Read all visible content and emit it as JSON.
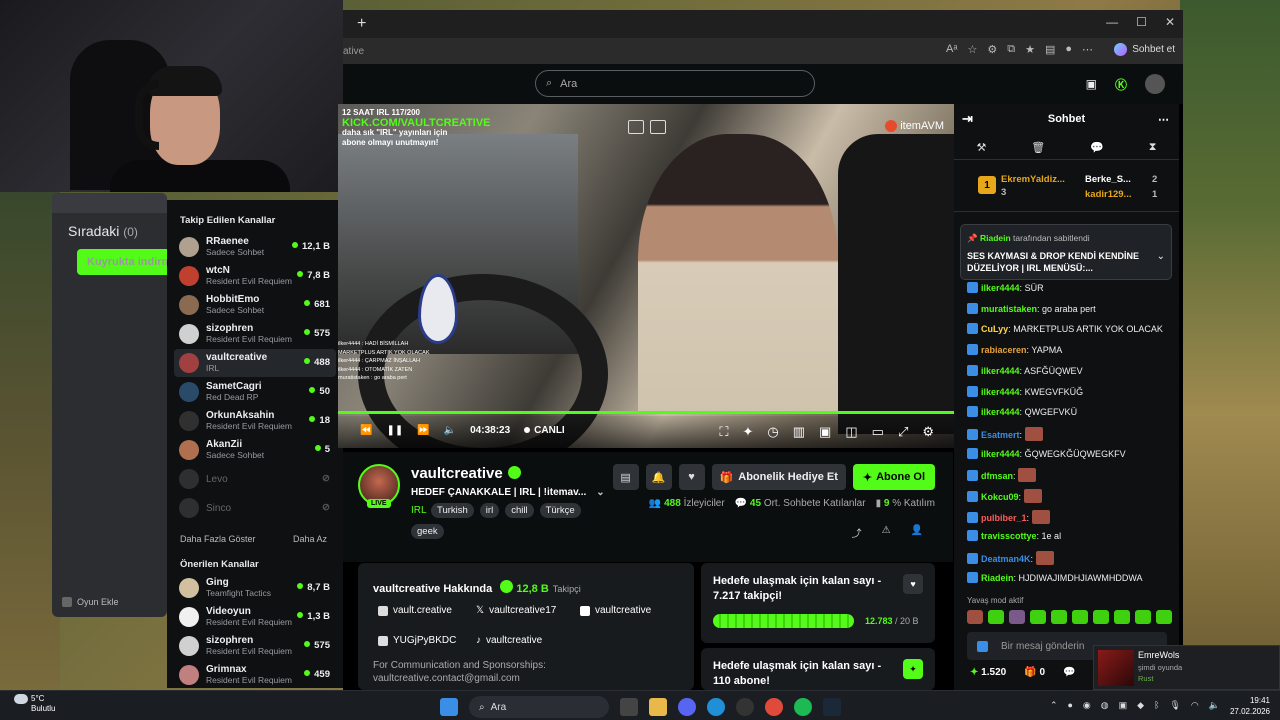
{
  "queue": {
    "title": "Sıradaki",
    "count": "(0)",
    "empty": "Kuyrukta indirme",
    "footer": "Oyun Ekle"
  },
  "browser": {
    "url_fragment": "ative",
    "sohbet_et": "Sohbet et"
  },
  "header": {
    "search_placeholder": "Ara"
  },
  "sidebar": {
    "followed_title": "Takip Edilen Kanallar",
    "followed": [
      {
        "name": "RRaenee",
        "category": "Sadece Sohbet",
        "viewers": "12,1 B",
        "color": "#b0a090"
      },
      {
        "name": "wtcN",
        "category": "Resident Evil Requiem",
        "viewers": "7,8 B",
        "color": "#c04030"
      },
      {
        "name": "HobbitEmo",
        "category": "Sadece Sohbet",
        "viewers": "681",
        "color": "#8a6a50"
      },
      {
        "name": "sizophren",
        "category": "Resident Evil Requiem",
        "viewers": "575",
        "color": "#d0d0d0"
      },
      {
        "name": "vaultcreative",
        "category": "IRL",
        "viewers": "488",
        "color": "#a04040"
      },
      {
        "name": "SametCagri",
        "category": "Red Dead RP",
        "viewers": "50",
        "color": "#2a4a6a"
      },
      {
        "name": "OrkunAksahin",
        "category": "Resident Evil Requiem",
        "viewers": "18",
        "color": "#303030"
      },
      {
        "name": "AkanZii",
        "category": "Sadece Sohbet",
        "viewers": "5",
        "color": "#b07050"
      },
      {
        "name": "Levo",
        "category": "",
        "viewers": "",
        "color": "#555"
      },
      {
        "name": "Sinco",
        "category": "",
        "viewers": "",
        "color": "#555"
      }
    ],
    "show_more": "Daha Fazla Göster",
    "show_less": "Daha Az",
    "recommended_title": "Önerilen Kanallar",
    "recommended": [
      {
        "name": "Ging",
        "category": "Teamfight Tactics",
        "viewers": "8,7 B",
        "color": "#d0c0a0"
      },
      {
        "name": "Videoyun",
        "category": "Resident Evil Requiem",
        "viewers": "1,3 B",
        "color": "#f0f0f0"
      },
      {
        "name": "sizophren",
        "category": "Resident Evil Requiem",
        "viewers": "575",
        "color": "#d0d0d0"
      },
      {
        "name": "Grimnax",
        "category": "Resident Evil Requiem",
        "viewers": "459",
        "color": "#c08080"
      }
    ]
  },
  "video": {
    "overlay_line1": "12 SAAT IRL 117/200",
    "overlay_kick": "KICK.COM/VAULTCREATIVE",
    "overlay_line3": "daha sık \"IRL\" yayınları için",
    "overlay_line4": "abone olmayı unutmayın!",
    "sponsor": "itemAVM",
    "time": "04:38:23",
    "live_label": "CANLI",
    "overlay_chat": [
      "ilker4444 : HADİ BİSMİLLAH",
      "MARKETPLUS ARTIK YOK OLACAK",
      "ilker4444 : ÇARPMAZ İNŞALLAH",
      "ilker4444 : OTOMATİK ZATEN",
      "muratistaken : go araba pert"
    ]
  },
  "stream": {
    "name": "vaultcreative",
    "title": "HEDEF ÇANAKKALE | IRL | !itemav...",
    "category": "IRL",
    "tags": [
      "Turkish",
      "irl",
      "chill",
      "Türkçe",
      "geek"
    ],
    "live_badge": "LIVE",
    "gift_label": "Abonelik Hediye Et",
    "subscribe_label": "Abone Ol",
    "viewers": "488",
    "viewers_label": "İzleyiciler",
    "chatters": "45",
    "chatters_label": "Ort. Sohbete Katılanlar",
    "participation": "9",
    "participation_label": "% Katılım"
  },
  "about": {
    "title": "vaultcreative Hakkında",
    "followers": "12,8 B",
    "followers_label": "Takipçi",
    "instagram": "vault.creative",
    "x": "vaultcreative17",
    "youtube": "vaultcreative",
    "discord": "YUGjPyBKDC",
    "tiktok": "vaultcreative",
    "desc_line1": "For Communication and Sponsorships:",
    "desc_line2": "vaultcreative.contact@gmail.com"
  },
  "goals": [
    {
      "title": "Hedefe ulaşmak için kalan sayı - 7.217 takipçi!",
      "current": "12.783",
      "target": "/ 20 B",
      "progress": 0.64
    },
    {
      "title": "Hedefe ulaşmak için kalan sayı - 110 abone!"
    }
  ],
  "chat": {
    "title": "Sohbet",
    "leaderboard": [
      {
        "name": "EkremYaldiz...",
        "count": "3"
      },
      {
        "name": "Berke_S...",
        "count": "2"
      },
      {
        "name": "kadir129...",
        "count": "1"
      }
    ],
    "pinned_by": "Riadein",
    "pinned_by_suffix": "tarafından sabitlendi",
    "pinned_msg": "SES KAYMASI & DROP KENDİ KENDİNE DÜZELİYOR | IRL MENÜSÜ:...",
    "messages": [
      {
        "user": "ilker4444",
        "text": "SÜR",
        "color": "#53fc18"
      },
      {
        "user": "muratistaken",
        "text": "go araba pert",
        "color": "#53fc18"
      },
      {
        "user": "CuLyy",
        "text": "MARKETPLUS ARTIK YOK OLACAK",
        "color": "#ffd84a"
      },
      {
        "user": "rabiaceren",
        "text": "YAPMA",
        "color": "#e8a23c"
      },
      {
        "user": "ilker4444",
        "text": "ASFĞÜQWEV",
        "color": "#53fc18"
      },
      {
        "user": "ilker4444",
        "text": "KWEGVFKÜĞ",
        "color": "#53fc18"
      },
      {
        "user": "ilker4444",
        "text": "QWGEFVKÜ",
        "color": "#53fc18"
      },
      {
        "user": "Esatmert",
        "text": "",
        "color": "#3a8ee6"
      },
      {
        "user": "ilker4444",
        "text": "ĞQWEGKĞÜQWEGKFV",
        "color": "#53fc18"
      },
      {
        "user": "dfmsan",
        "text": "",
        "color": "#53fc18"
      },
      {
        "user": "Kokcu09",
        "text": "",
        "color": "#53fc18"
      },
      {
        "user": "pulbiber_1",
        "text": "",
        "color": "#ff5a5a"
      },
      {
        "user": "travisscottye",
        "text": "1e al",
        "color": "#53fc18"
      },
      {
        "user": "Deatman4K",
        "text": "",
        "color": "#3a8ee6"
      },
      {
        "user": "Riadein",
        "text": "HJDIWAJIMDHJIAWMHDDWA",
        "color": "#53fc18"
      }
    ],
    "slow_mode": "Yavaş mod aktif",
    "input_placeholder": "Bir mesaj gönderin",
    "points": "1.520",
    "zero": "0"
  },
  "toast": {
    "name": "EmreWols",
    "status": "şimdi oyunda",
    "game": "Rust"
  },
  "taskbar": {
    "temp": "5°C",
    "weather": "Bulutlu",
    "search": "Ara",
    "time": "19:41",
    "date": "27.02.2026"
  }
}
